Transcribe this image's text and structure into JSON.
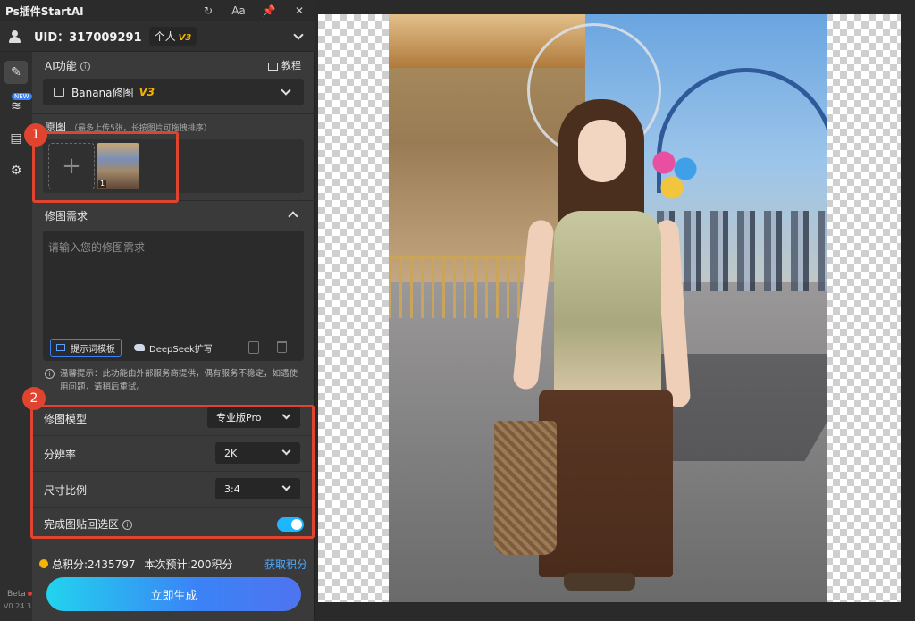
{
  "titlebar": {
    "title": "Ps插件StartAI",
    "icons": [
      "refresh-icon",
      "font-icon",
      "pin-icon",
      "close-icon"
    ],
    "font_icon_label": "Aa"
  },
  "user": {
    "uid_label": "UID：317009291",
    "plan": "个人",
    "plan_tier": "V3"
  },
  "ai": {
    "section_label": "AI功能",
    "tutorial_label": "教程",
    "model_name": "Banana修图",
    "model_version": "V3"
  },
  "rail": {
    "new_badge": "NEW",
    "beta_label": "Beta",
    "version": "V0.24.3"
  },
  "source": {
    "label": "原图",
    "hint": "（最多上传5张，长按图片可拖拽排序）",
    "add_label": "+",
    "thumb_index": "1"
  },
  "request": {
    "label": "修图需求",
    "placeholder": "请输入您的修图需求",
    "template_label": "提示词模板",
    "deepseek_label": "DeepSeek扩写"
  },
  "warning": {
    "text": "温馨提示：此功能由外部服务商提供，偶有服务不稳定，如遇使用问题，请稍后重试。"
  },
  "settings": {
    "model_label": "修图模型",
    "model_value": "专业版Pro",
    "resolution_label": "分辨率",
    "resolution_value": "2K",
    "ratio_label": "尺寸比例",
    "ratio_value": "3:4",
    "paste_back_label": "完成图贴回选区",
    "paste_back_on": true
  },
  "annotations": {
    "badge1": "1",
    "badge2": "2",
    "color": "#e0442f"
  },
  "points": {
    "total": "总积分:2435797",
    "estimate": "本次预计:200积分",
    "get_label": "获取积分"
  },
  "generate": {
    "label": "立即生成"
  },
  "colors": {
    "accent": "#3b82f6",
    "toggle": "#1fb6ff",
    "gold": "#f5b400"
  }
}
